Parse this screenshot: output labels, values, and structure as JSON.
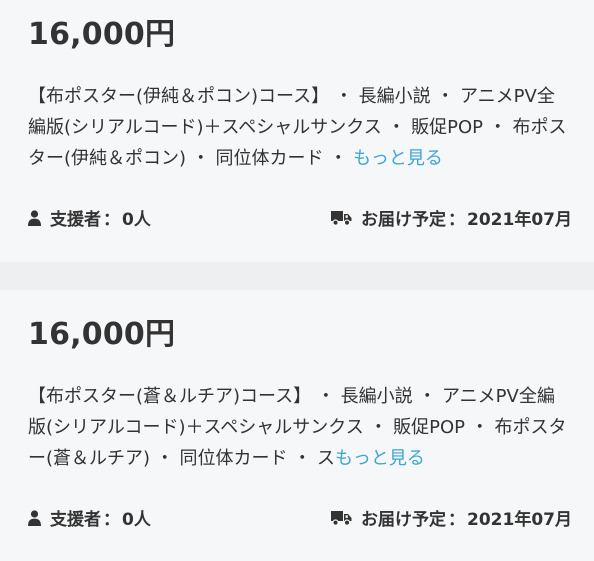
{
  "rewards": [
    {
      "price": "16,000円",
      "description": "【布ポスター(伊純＆ポコン)コース】 ・ 長編小説 ・ アニメPV全編版(シリアルコード)＋スペシャルサンクス ・ 販促POP ・ 布ポスター(伊純＆ポコン) ・ 同位体カード ・ ",
      "more_label": "もっと見る",
      "supporters_label": "支援者",
      "supporters_value": "0人",
      "delivery_label": "お届け予定",
      "delivery_value": "2021年07月",
      "supporters_icon": "person-icon",
      "delivery_icon": "truck-icon"
    },
    {
      "price": "16,000円",
      "description": "【布ポスター(蒼＆ルチア)コース】 ・ 長編小説 ・ アニメPV全編版(シリアルコード)＋スペシャルサンクス ・ 販促POP ・ 布ポスター(蒼＆ルチア) ・ 同位体カード ・ ス",
      "more_label": "もっと見る",
      "supporters_label": "支援者",
      "supporters_value": "0人",
      "delivery_label": "お届け予定",
      "delivery_value": "2021年07月",
      "supporters_icon": "person-icon",
      "delivery_icon": "truck-icon"
    }
  ],
  "separator": "：",
  "colors": {
    "link": "#3ba6d6",
    "text": "#333333",
    "card_bg": "#f6f7f9",
    "page_bg": "#eeeff1"
  }
}
